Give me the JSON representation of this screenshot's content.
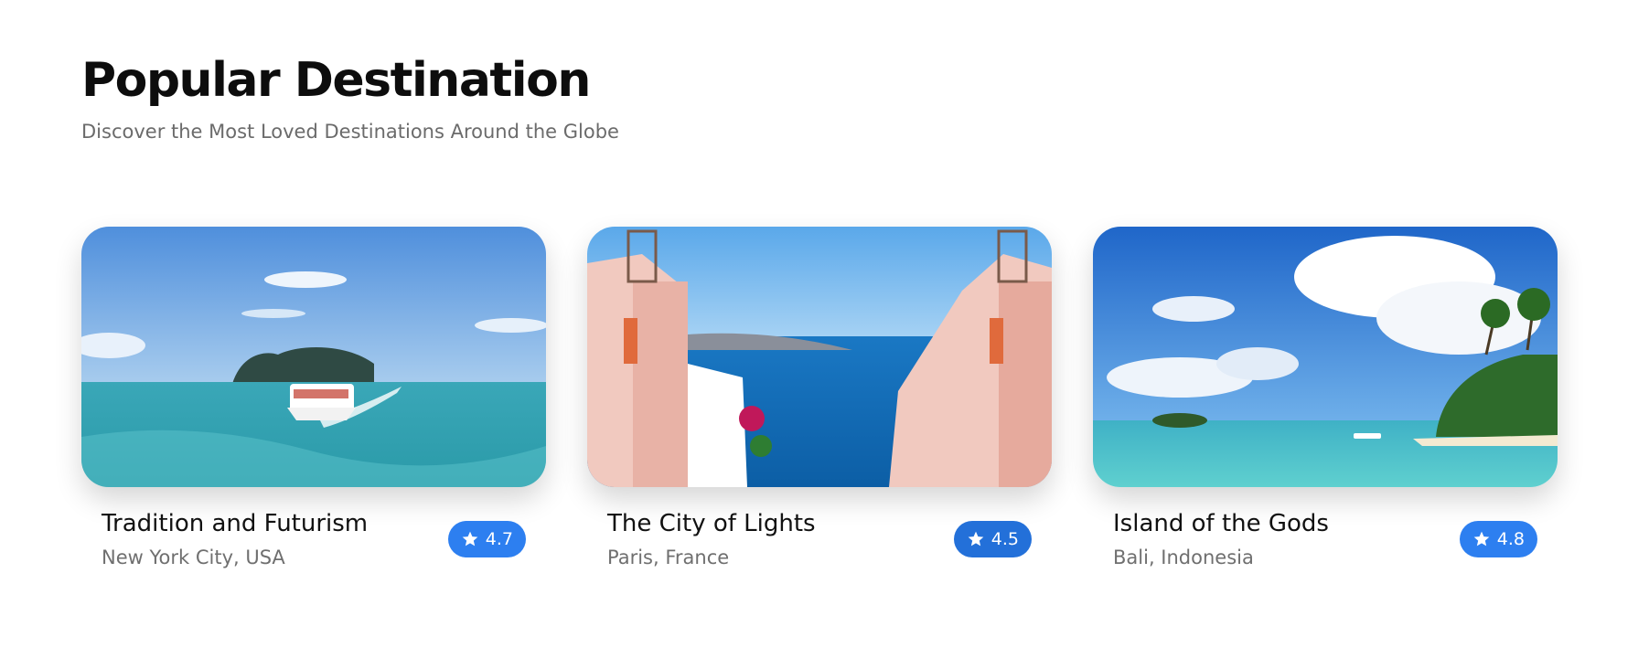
{
  "header": {
    "title": "Popular Destination",
    "subtitle": "Discover the Most Loved Destinations Around the Globe"
  },
  "cards": [
    {
      "title": "Tradition and Futurism",
      "location": "New York City, USA",
      "rating": "4.7",
      "image": "boat-sea-photo"
    },
    {
      "title": "The City of Lights",
      "location": "Paris, France",
      "rating": "4.5",
      "image": "santorini-photo"
    },
    {
      "title": "Island of the Gods",
      "location": "Bali, Indonesia",
      "rating": "4.8",
      "image": "tropical-beach-photo"
    }
  ],
  "icons": {
    "rating": "star-icon"
  },
  "colors": {
    "badge": "#2d7ff0",
    "badge_alt": "#2370d9",
    "title": "#0d0d0d",
    "muted": "#6b6b6b"
  }
}
